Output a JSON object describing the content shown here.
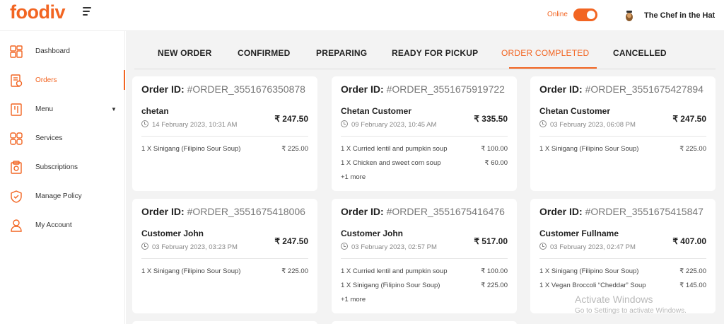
{
  "header": {
    "logo": "foodiv",
    "online_label": "Online",
    "chef_name": "The Chef in the Hat"
  },
  "colors": {
    "accent": "#f26522",
    "background": "#f3f3f3"
  },
  "sidebar": {
    "items": [
      {
        "label": "Dashboard",
        "icon": "dashboard-icon"
      },
      {
        "label": "Orders",
        "icon": "orders-icon"
      },
      {
        "label": "Menu",
        "icon": "menu-icon"
      },
      {
        "label": "Services",
        "icon": "services-icon"
      },
      {
        "label": "Subscriptions",
        "icon": "subscriptions-icon"
      },
      {
        "label": "Manage Policy",
        "icon": "shield-icon"
      },
      {
        "label": "My Account",
        "icon": "user-icon"
      }
    ]
  },
  "tabs": [
    {
      "label": "NEW ORDER"
    },
    {
      "label": "CONFIRMED"
    },
    {
      "label": "PREPARING"
    },
    {
      "label": "READY FOR PICKUP"
    },
    {
      "label": "ORDER COMPLETED"
    },
    {
      "label": "CANCELLED"
    }
  ],
  "order_id_label": "Order ID:",
  "orders": [
    {
      "id": "#ORDER_3551676350878",
      "customer": "chetan",
      "date": "14 February 2023, 10:31 AM",
      "total": "₹ 247.50",
      "items": [
        {
          "text": "1 X  Sinigang (Filipino Sour Soup)",
          "price": "₹ 225.00"
        }
      ],
      "more": ""
    },
    {
      "id": "#ORDER_3551675919722",
      "customer": "Chetan Customer",
      "date": "09 February 2023, 10:45 AM",
      "total": "₹ 335.50",
      "items": [
        {
          "text": "1 X  Curried lentil and pumpkin soup",
          "price": "₹ 100.00"
        },
        {
          "text": "1 X  Chicken and sweet corn soup",
          "price": "₹ 60.00"
        }
      ],
      "more": "+1 more"
    },
    {
      "id": "#ORDER_3551675427894",
      "customer": "Chetan Customer",
      "date": "03 February 2023, 06:08 PM",
      "total": "₹ 247.50",
      "items": [
        {
          "text": "1 X  Sinigang (Filipino Sour Soup)",
          "price": "₹ 225.00"
        }
      ],
      "more": ""
    },
    {
      "id": "#ORDER_3551675418006",
      "customer": "Customer John",
      "date": "03 February 2023, 03:23 PM",
      "total": "₹ 247.50",
      "items": [
        {
          "text": "1 X  Sinigang (Filipino Sour Soup)",
          "price": "₹ 225.00"
        }
      ],
      "more": ""
    },
    {
      "id": "#ORDER_3551675416476",
      "customer": "Customer John",
      "date": "03 February 2023, 02:57 PM",
      "total": "₹ 517.00",
      "items": [
        {
          "text": "1 X  Curried lentil and pumpkin soup",
          "price": "₹ 100.00"
        },
        {
          "text": "1 X  Sinigang (Filipino Sour Soup)",
          "price": "₹ 225.00"
        }
      ],
      "more": "+1 more"
    },
    {
      "id": "#ORDER_3551675415847",
      "customer": "Customer Fullname",
      "date": "03 February 2023, 02:47 PM",
      "total": "₹ 407.00",
      "items": [
        {
          "text": "1 X  Sinigang (Filipino Sour Soup)",
          "price": "₹ 225.00"
        },
        {
          "text": "1 X  Vegan Broccoli “Cheddar” Soup",
          "price": "₹ 145.00"
        }
      ],
      "more": ""
    }
  ],
  "watermark": {
    "title": "Activate Windows",
    "subtitle": "Go to Settings to activate Windows."
  }
}
